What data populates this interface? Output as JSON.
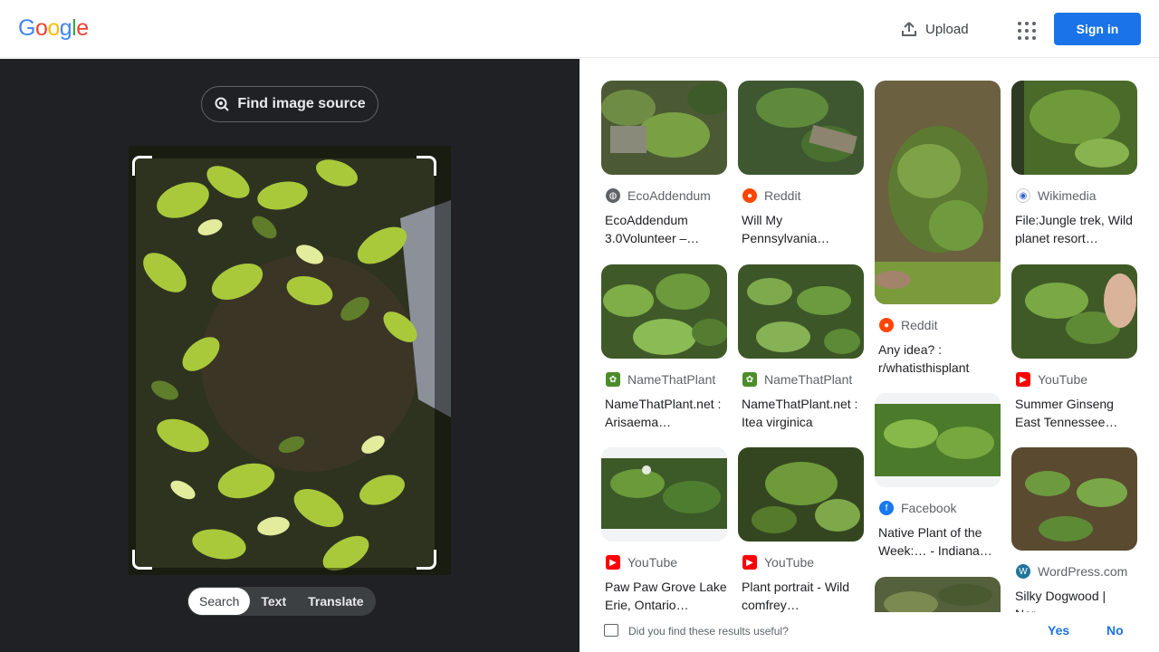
{
  "header": {
    "logo_letters": [
      {
        "ch": "G",
        "color": "#4285f4"
      },
      {
        "ch": "o",
        "color": "#ea4335"
      },
      {
        "ch": "o",
        "color": "#fbbc05"
      },
      {
        "ch": "g",
        "color": "#4285f4"
      },
      {
        "ch": "l",
        "color": "#34a853"
      },
      {
        "ch": "e",
        "color": "#ea4335"
      }
    ],
    "upload_label": "Upload",
    "signin_label": "Sign in"
  },
  "left": {
    "find_source_label": "Find image source",
    "modes": [
      "Search",
      "Text",
      "Translate"
    ],
    "active_mode": "Search"
  },
  "results": [
    {
      "source": "EcoAddendum",
      "title": "EcoAddendum 3.0Volunteer –…",
      "fav": "globe",
      "fav_color": "#5f6368"
    },
    {
      "source": "Reddit",
      "title": "Will My Pennsylvania…",
      "fav": "reddit",
      "fav_color": "#ff4500"
    },
    {
      "source": "Reddit",
      "title": "Any idea? : r/whatisthisplant",
      "fav": "reddit",
      "fav_color": "#ff4500"
    },
    {
      "source": "Wikimedia",
      "title": "File:Jungle trek, Wild planet resort…",
      "fav": "wikimedia",
      "fav_color": "#3366cc"
    },
    {
      "source": "NameThatPlant",
      "title": "NameThatPlant.net : Arisaema…",
      "fav": "leaf",
      "fav_color": "#4c8c2b"
    },
    {
      "source": "NameThatPlant",
      "title": "NameThatPlant.net : Itea virginica",
      "fav": "leaf",
      "fav_color": "#4c8c2b"
    },
    {
      "source": "YouTube",
      "title": "Summer Ginseng East Tennessee…",
      "fav": "youtube",
      "fav_color": "#ff0000"
    },
    {
      "source": "Facebook",
      "title": "Native Plant of the Week:… - Indiana…",
      "fav": "facebook",
      "fav_color": "#1877f2"
    },
    {
      "source": "YouTube",
      "title": "Paw Paw Grove Lake Erie, Ontario…",
      "fav": "youtube",
      "fav_color": "#ff0000"
    },
    {
      "source": "YouTube",
      "title": "Plant portrait - Wild comfrey…",
      "fav": "youtube",
      "fav_color": "#ff0000"
    },
    {
      "source": "WordPress.com",
      "title": "Silky Dogwood | Nor…",
      "fav": "wordpress",
      "fav_color": "#21759b"
    }
  ],
  "feedback": {
    "question": "Did you find these results useful?",
    "yes": "Yes",
    "no": "No"
  }
}
